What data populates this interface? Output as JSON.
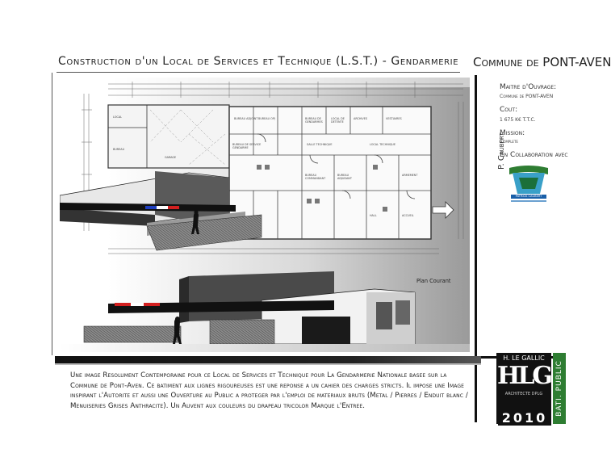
{
  "header": {
    "title": "Construction d'un Local de Services et Technique (L.S.T.) - Gendarmerie",
    "commune": "Commune de PONT-AVEN"
  },
  "sidebar": {
    "owner_label": "Maitre d'Ouvrage:",
    "owner_value": "Commune de PONT-AVEN",
    "cost_label": "Cout:",
    "cost_value": "1 675 K€ T.T.C.",
    "mission_label": "Mission:",
    "mission_value": "Complete",
    "collab_label": "En Collaboration avec",
    "collab_name": "P. Caubert",
    "collab_logo_text": "PATRICK CAUBERT"
  },
  "plan": {
    "caption": "Plan Courant",
    "rooms": [
      "Bureau Adjoint",
      "Bureau OPJ",
      "Bureau de Gendarmes",
      "Bureau de Service Gendarme",
      "Salle Technique",
      "Local Technique",
      "Archives",
      "Bureau Commandant de Brigade",
      "Bureau Adjudant",
      "Local de Détente",
      "Accueil",
      "Garage",
      "Armement",
      "Vestiaires",
      "Hall"
    ]
  },
  "description": "Une image Resolument Contemporaine pour ce Local de Services et Technique pour La Gendarmerie Nationale basee sur la Commune de Pont-Aven. Ce batiment aux lignes rigoureuses est une reponse a un cahier des charges stricts. Il impose une Image inspirant l'Autorite et aussi une Ouverture au Public a proteger par l'emploi de materiaux bruts (Metal / Pierres / Enduit blanc / Menuiseries Grises Anthracite). Un Auvent aux couleurs du drapeau tricolor Marque l'Entree.",
  "branding": {
    "architect": "H. LE GALLIC",
    "letters": "HLG",
    "subtitle": "ARCHITECTE DPLG",
    "year": "2010",
    "category": "BATI. PUBLIC"
  },
  "colors": {
    "accent_green": "#2e7d32",
    "flag_blue": "#1f3fbf",
    "flag_red": "#d21f1f"
  }
}
